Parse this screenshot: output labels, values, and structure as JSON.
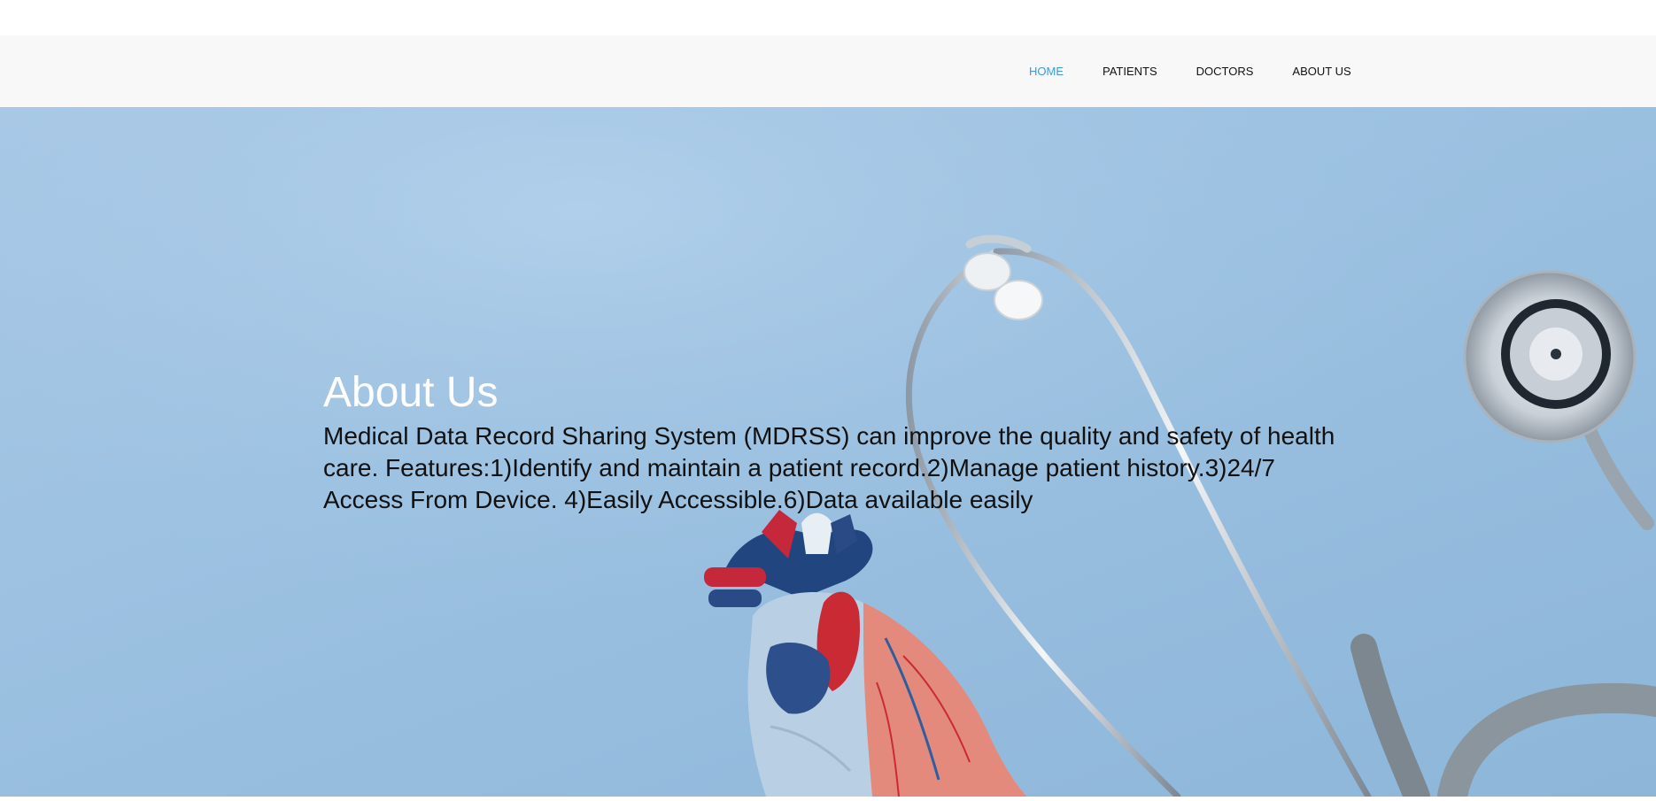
{
  "nav": {
    "items": [
      {
        "label": "HOME",
        "active": true
      },
      {
        "label": "PATIENTS",
        "active": false
      },
      {
        "label": "DOCTORS",
        "active": false
      },
      {
        "label": "ABOUT US",
        "active": false
      }
    ],
    "active_color": "#3c9ad6"
  },
  "hero": {
    "title": "About Us",
    "description": "Medical Data Record Sharing System (MDRSS) can improve the quality and safety of health care. Features:1)Identify and maintain a patient record.2)Manage patient history.3)24/7 Access From Device. 4)Easily Accessible.6)Data available easily",
    "background_color": "#9cc1e1",
    "image_subjects": [
      "stethoscope-image",
      "anatomical-heart-model-image"
    ]
  }
}
